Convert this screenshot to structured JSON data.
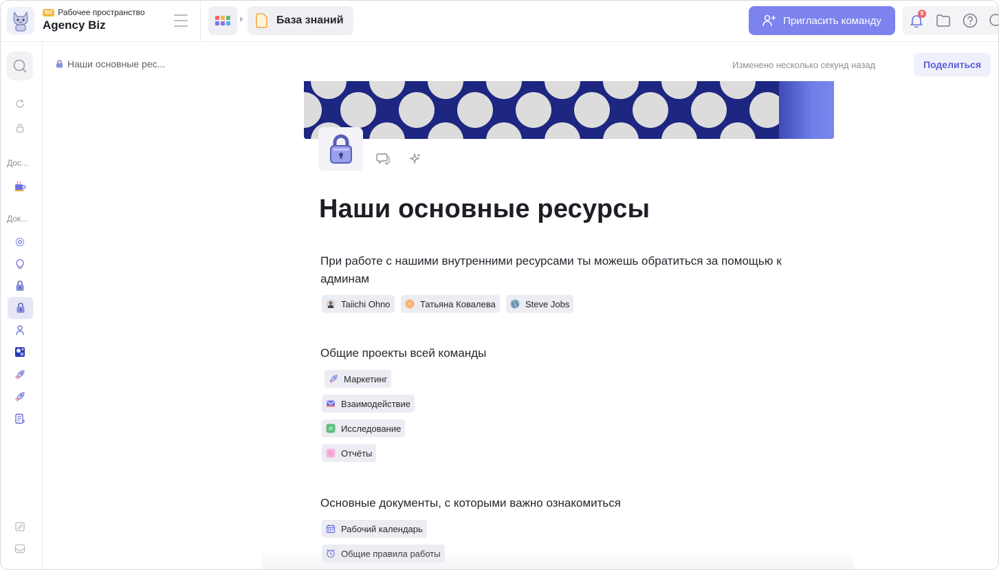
{
  "workspace": {
    "badge": "BIZ",
    "label": "Рабочее пространство",
    "name": "Agency Biz",
    "avatar_icon": "cat-mascot-icon"
  },
  "header": {
    "breadcrumb_current": "База знаний",
    "invite_label": "Пригласить команду",
    "notification_count": "8",
    "accent_color": "#7c82ee"
  },
  "sidebar": {
    "section_1": "Дос...",
    "section_2": "Док..."
  },
  "page": {
    "crumb": "Наши основные рес...",
    "modified": "Изменено несколько секунд назад",
    "share_label": "Поделиться",
    "title": "Наши основные ресурсы",
    "intro": "При работе с нашими внутренними ресурсами ты можешь обратиться за помощью к админам",
    "admins": [
      {
        "name": "Taiichi Ohno",
        "icon": "man-avatar-icon"
      },
      {
        "name": "Татьяна Ковалева",
        "icon": "orange-circle-avatar-icon"
      },
      {
        "name": "Steve Jobs",
        "icon": "globe-avatar-icon"
      }
    ],
    "projects_heading": "Общие проекты всей команды",
    "projects": [
      {
        "name": "Маркетинг",
        "icon": "rocket-icon"
      },
      {
        "name": "Взаимодействие",
        "icon": "envelope-icon"
      },
      {
        "name": "Исследование",
        "icon": "green-square-icon",
        "letter": "И"
      },
      {
        "name": "Отчёты",
        "icon": "pink-square-icon",
        "letter": "О"
      }
    ],
    "docs_heading": "Основные документы, с которыми важно ознакомиться",
    "docs": [
      {
        "name": "Рабочий календарь",
        "icon": "calendar-icon"
      },
      {
        "name": "Общие правила работы",
        "icon": "alarm-clock-icon"
      }
    ]
  }
}
